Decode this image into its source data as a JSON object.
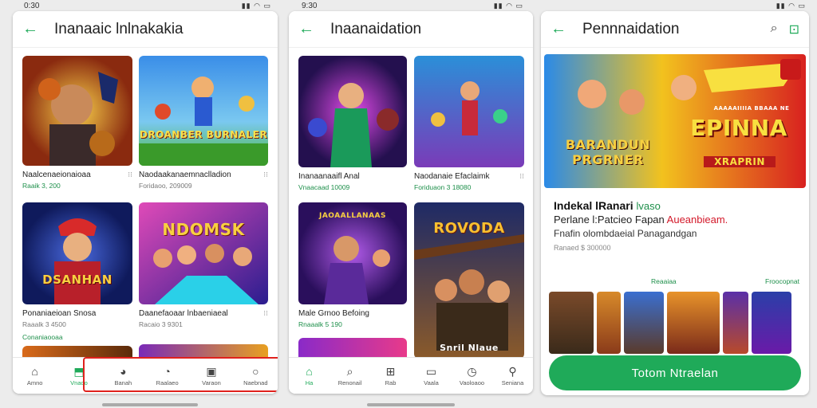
{
  "status_bars": [
    {
      "time": "0:30",
      "icons": "▮▮ ◠ ▭"
    },
    {
      "time": "9:30",
      "icons": "▮▮ ◠ ▭"
    },
    {
      "time": "",
      "icons": "▮▮ ◠ ▭"
    }
  ],
  "screen1": {
    "title": "Inanaaic lnlnakakia",
    "cards": [
      {
        "title": "Naalcenaeionaioaa",
        "meta": "Raaik 3, 200",
        "art": "",
        "c1": "#f2a33a",
        "c2": "#6b2a0f"
      },
      {
        "title": "Naodaakanaemnaclladion",
        "meta": "Foridaoo, 209009",
        "art": "DROANBER BURNALER",
        "c1": "#3a8ee8",
        "c2": "#4fb83d"
      },
      {
        "title": "Ponaniaeioan Snosa",
        "meta": "Raaalk 3 4500",
        "art": "DSANHAN",
        "c1": "#2d3bb5",
        "c2": "#0f1a5c"
      },
      {
        "title": "Daanefaoaar lnbaeniaeal",
        "meta": "Racaio 3 9301",
        "art": "NDOMSK",
        "c1": "#c23aa8",
        "c2": "#3a1d8f"
      }
    ],
    "more_label": "Conaniaooaa",
    "nav": [
      {
        "icon": "⌂",
        "label": "Amno"
      },
      {
        "icon": "⬒",
        "label": "Vnaoo"
      },
      {
        "icon": "◕",
        "label": "Banah"
      },
      {
        "icon": "◔",
        "label": "Raalaeo"
      },
      {
        "icon": "▣",
        "label": "Varaon"
      },
      {
        "icon": "○",
        "label": "Naebnad"
      }
    ]
  },
  "screen2": {
    "title": "Inaanaidation",
    "cards": [
      {
        "title": "Inanaanaaifl Anal",
        "meta": "Vnaacaad 10009",
        "art": "",
        "c1": "#b02bd0",
        "c2": "#24104f"
      },
      {
        "title": "Naodanaie Efaclaimk",
        "meta": "Foriduaon 3 18080",
        "art": "",
        "c1": "#2b8fd8",
        "c2": "#7a3bb8"
      },
      {
        "title": "Male Grnoo Befoing",
        "meta": "Rnaaalk 5 190",
        "art": "JAOAALLANAAS",
        "c1": "#7b2fc2",
        "c2": "#2a0f5c"
      },
      {
        "title": "",
        "meta": "",
        "art": "ROVODA",
        "art2": "Snril Nlaue",
        "c1": "#1e2a66",
        "c2": "#8a5a2a"
      }
    ],
    "nav": [
      {
        "icon": "⌂",
        "label": "Ha"
      },
      {
        "icon": "⌕",
        "label": "Renonail"
      },
      {
        "icon": "⊞",
        "label": "Rab"
      },
      {
        "icon": "▭",
        "label": "Vaala"
      },
      {
        "icon": "◷",
        "label": "Vaoloaoo"
      },
      {
        "icon": "⚲",
        "label": "Seniana"
      }
    ]
  },
  "screen3": {
    "title": "Pennnaidation",
    "banner": {
      "small_text": "AAAAAIIIIA BBAAA NE",
      "big_text": "EPINNA",
      "left_text": "BARANDUN PRGRNER",
      "sub_text": "XRAPRIN",
      "c1": "#f2c21e",
      "c2": "#d8211f"
    },
    "detail": {
      "name": "Indekal lRanari",
      "tag": "lvaso",
      "sub_prefix": "Perlane l:Patcieo Fapan",
      "sub_red": "Aueanbieam.",
      "sub2": "Fnafin olombdaeial Panagandgan",
      "meta": "Ranaed $ 300000"
    },
    "section_left": "Reaaiaa",
    "section_right": "Froocopnat",
    "install_label": "Totom Ntraelan",
    "shots": [
      "#7a4a2a",
      "#d88a2a",
      "#3a6fd0",
      "#e8932a",
      "#5a2fa8",
      "#2a3fa8"
    ]
  },
  "colors": {
    "accent": "#1faa59",
    "highlight": "#e0211d"
  }
}
